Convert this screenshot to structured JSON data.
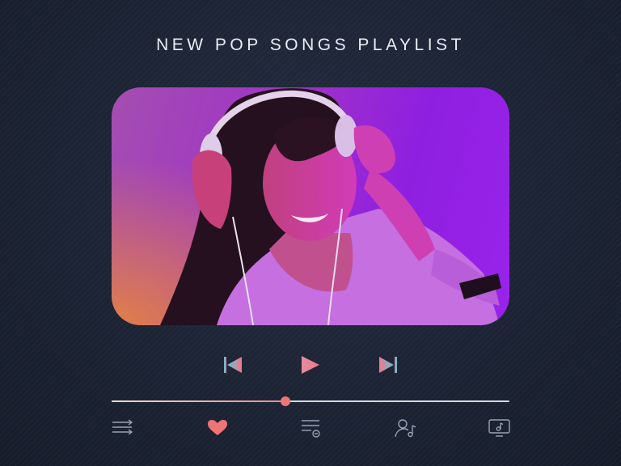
{
  "playlist": {
    "title": "NEW POP SONGS PLAYLIST",
    "cover_image": "woman-with-headphones-photo"
  },
  "player": {
    "controls": {
      "previous": "skip-previous-icon",
      "play": "play-icon",
      "next": "skip-next-icon"
    },
    "progress_fraction": 0.438
  },
  "toolbar": {
    "icons": [
      "queue-icon",
      "heart-icon",
      "playlist-icon",
      "artist-icon",
      "music-screen-icon"
    ]
  },
  "colors": {
    "background": "#1b2334",
    "accent": "#ef7476",
    "control_gradient_start": "#5fc5d8",
    "control_gradient_end": "#f0788a",
    "icon_outline": "#9aa3b4",
    "title_text": "#e9ecf2"
  }
}
